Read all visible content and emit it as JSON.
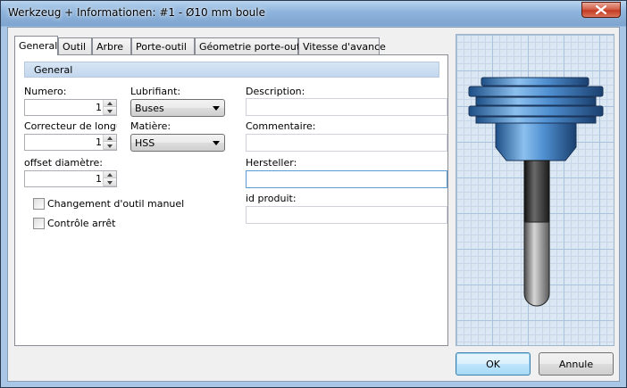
{
  "window": {
    "title": "Werkzeug + Informationen: #1 - Ø10 mm boule"
  },
  "tabs": [
    {
      "label": "General",
      "active": true
    },
    {
      "label": "Outil"
    },
    {
      "label": "Arbre"
    },
    {
      "label": "Porte-outil"
    },
    {
      "label": "Géometrie porte-outil"
    },
    {
      "label": "Vitesse d'avance"
    }
  ],
  "general": {
    "header": "General",
    "numero": {
      "label": "Numero:",
      "value": "1"
    },
    "correcteur": {
      "label": "Correcteur de longueur:",
      "value": "1"
    },
    "offset": {
      "label": "offset diamètre:",
      "value": "1"
    },
    "lubrifiant": {
      "label": "Lubrifiant:",
      "value": "Buses"
    },
    "matiere": {
      "label": "Matière:",
      "value": "HSS"
    },
    "description": {
      "label": "Description:",
      "value": ""
    },
    "commentaire": {
      "label": "Commentaire:",
      "value": ""
    },
    "hersteller": {
      "label": "Hersteller:",
      "value": ""
    },
    "id_produit": {
      "label": "id produit:",
      "value": ""
    },
    "changement": {
      "label": "Changement d'outil manuel",
      "checked": false
    },
    "controle": {
      "label": "Contrôle arrêt",
      "checked": false
    }
  },
  "buttons": {
    "ok": "OK",
    "cancel": "Annule"
  },
  "colors": {
    "titlebar": "#8fb4dc",
    "close": "#c33b23",
    "tool_blue": "#4f8fd0",
    "shank": "#3a3a3a",
    "tip": "#9a9a9a",
    "grid": "#dbe8f4"
  }
}
